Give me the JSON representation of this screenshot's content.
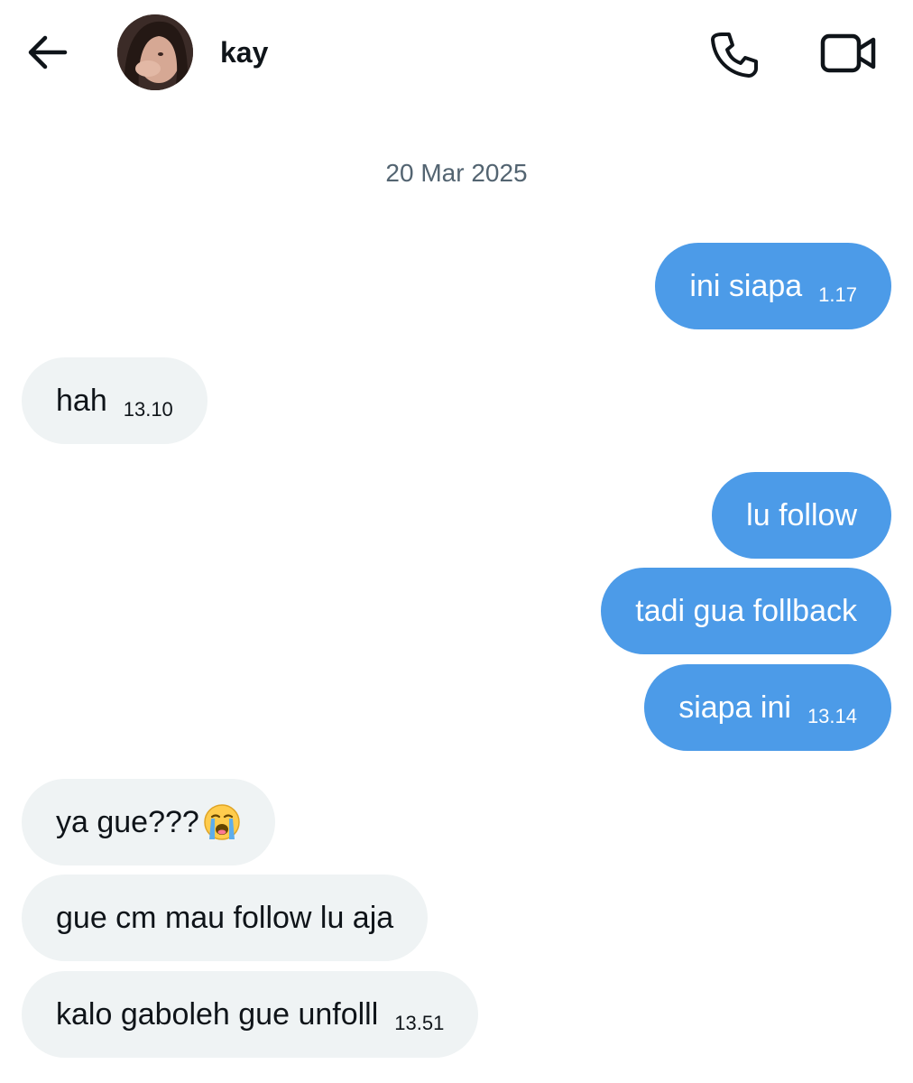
{
  "header": {
    "contact_name": "kay",
    "icons": {
      "back": "arrow-left-icon",
      "call": "phone-icon",
      "video": "video-camera-icon"
    }
  },
  "conversation": {
    "date_separator": "20 Mar 2025",
    "messages": [
      {
        "direction": "outgoing",
        "text": "ini siapa",
        "time": "1.17"
      },
      {
        "direction": "incoming",
        "text": "hah",
        "time": "13.10"
      },
      {
        "direction": "outgoing",
        "text": "lu follow",
        "time": ""
      },
      {
        "direction": "outgoing",
        "text": "tadi gua follback",
        "time": ""
      },
      {
        "direction": "outgoing",
        "text": "siapa ini",
        "time": "13.14"
      },
      {
        "direction": "incoming",
        "text": "ya gue???",
        "emoji": "loudly-crying-face",
        "time": ""
      },
      {
        "direction": "incoming",
        "text": "gue cm mau follow lu aja",
        "time": ""
      },
      {
        "direction": "incoming",
        "text": "kalo gaboleh gue unfolll",
        "time": "13.51"
      }
    ]
  },
  "colors": {
    "outgoing_bubble": "#4c9be8",
    "incoming_bubble": "#eff3f4",
    "date_text": "#536471"
  }
}
